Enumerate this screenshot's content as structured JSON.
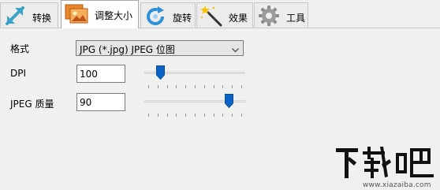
{
  "tabs": [
    {
      "label": "转换",
      "icon": "resize-arrows-icon",
      "active": false
    },
    {
      "label": "调整大小",
      "icon": "image-resize-icon",
      "active": true
    },
    {
      "label": "旋转",
      "icon": "rotate-icon",
      "active": false
    },
    {
      "label": "效果",
      "icon": "magic-wand-icon",
      "active": false
    },
    {
      "label": "工具",
      "icon": "gear-icon",
      "active": false
    }
  ],
  "form": {
    "format_label": "格式",
    "format_value": "JPG (*.jpg) JPEG 位图",
    "dpi_label": "DPI",
    "dpi_value": "100",
    "dpi_slider_fraction": 0.13,
    "quality_label": "JPEG 质量",
    "quality_value": "90",
    "quality_slider_fraction": 0.87
  },
  "watermark": {
    "url": "www.xiazaiba.com"
  },
  "colors": {
    "accent": "#0b63c7",
    "tab_active_bg": "#ffffff",
    "panel_bg": "#f0f0f0"
  }
}
